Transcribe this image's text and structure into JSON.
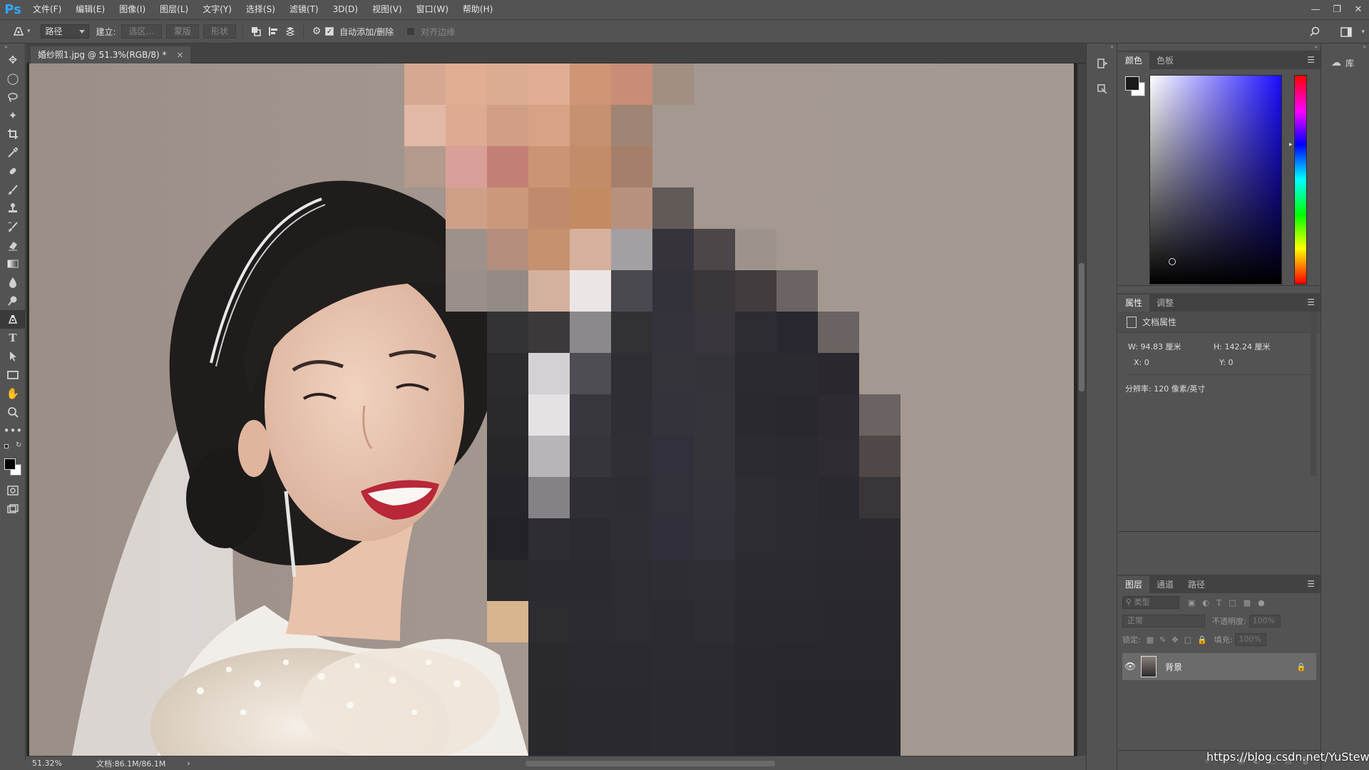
{
  "app": {
    "logo": "Ps",
    "menus": [
      "文件(F)",
      "编辑(E)",
      "图像(I)",
      "图层(L)",
      "文字(Y)",
      "选择(S)",
      "滤镜(T)",
      "3D(D)",
      "视图(V)",
      "窗口(W)",
      "帮助(H)"
    ]
  },
  "options": {
    "mode": "路径",
    "make_label": "建立:",
    "btn_selection": "选区...",
    "btn_mask": "蒙版",
    "btn_shape": "形状",
    "auto_add_delete": "自动添加/删除",
    "align_edges": "对齐边缘"
  },
  "document": {
    "tab_title": "婚纱照1.jpg @ 51.3%(RGB/8) *",
    "tab_close": "×"
  },
  "status": {
    "zoom": "51.32%",
    "doc_size": "文档:86.1M/86.1M",
    "arrow": "›"
  },
  "color_panel": {
    "tab_color": "颜色",
    "tab_swatches": "色板",
    "foreground": "#1a1a1a",
    "background": "#ffffff"
  },
  "properties_panel": {
    "tab_properties": "属性",
    "tab_adjust": "调整",
    "doc_props": "文档属性",
    "w_label": "W:",
    "w_value": "94.83 厘米",
    "h_label": "H:",
    "h_value": "142.24 厘米",
    "x_label": "X:",
    "x_value": "0",
    "y_label": "Y:",
    "y_value": "0",
    "resolution": "分辨率: 120 像素/英寸"
  },
  "layers_panel": {
    "tab_layers": "图层",
    "tab_channels": "通道",
    "tab_paths": "路径",
    "filter_placeholder": "类型",
    "blend_mode": "正常",
    "opacity_label": "不透明度:",
    "opacity_value": "100%",
    "lock_label": "锁定:",
    "fill_label": "填充:",
    "fill_value": "100%",
    "layer_name": "背景"
  },
  "library": {
    "label": "库"
  },
  "watermark": "https://blog.csdn.net/YuStewart"
}
